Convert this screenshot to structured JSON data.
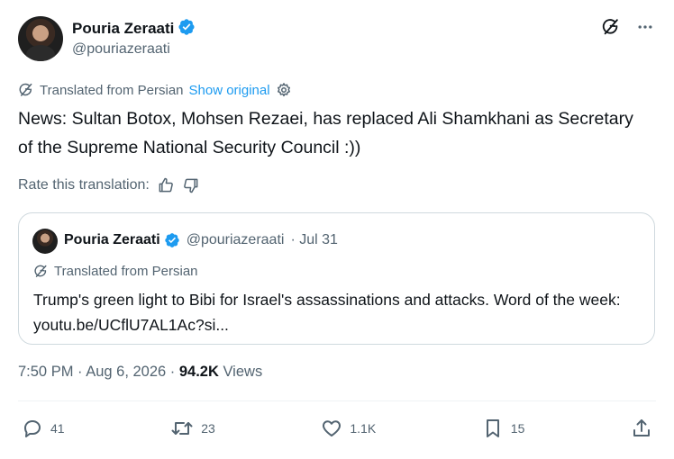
{
  "author": {
    "name": "Pouria Zeraati",
    "handle": "@pouriazeraati"
  },
  "translation": {
    "label": "Translated from Persian",
    "show_original": "Show original"
  },
  "tweet": {
    "text": "News: Sultan Botox, Mohsen Rezaei, has replaced Ali Shamkhani as Secretary of the Supreme National Security Council :))"
  },
  "rate": {
    "label": "Rate this translation:"
  },
  "quote": {
    "name": "Pouria Zeraati",
    "handle": "@pouriazeraati",
    "date": "· Jul 31",
    "translated_label": "Translated from Persian",
    "text": "Trump's green light to Bibi for Israel's assassinations and attacks. Word of the week: youtu.be/UCflU7AL1Ac?si..."
  },
  "meta": {
    "time": "7:50 PM · Aug 6, 2026 · ",
    "views_count": "94.2K",
    "views_label": " Views"
  },
  "actions": {
    "replies": "41",
    "reposts": "23",
    "likes": "1.1K",
    "bookmarks": "15"
  },
  "colors": {
    "accent": "#1d9bf0",
    "text": "#0f1419",
    "secondary": "#536471",
    "border": "#cfd9de"
  }
}
